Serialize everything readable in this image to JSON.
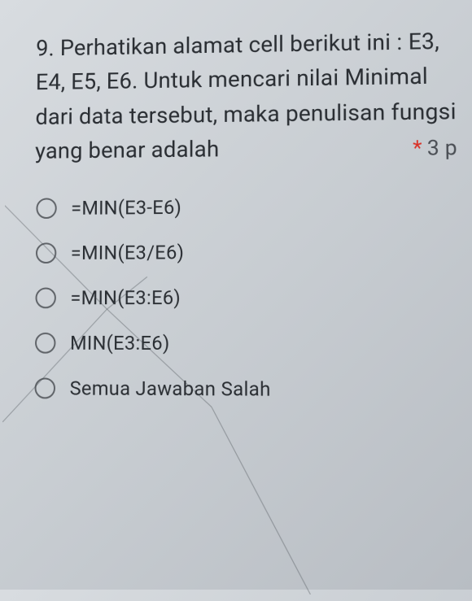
{
  "question": {
    "number": "9.",
    "text": "Perhatikan alamat cell berikut ini : E3, E4, E5, E6.  Untuk mencari nilai Minimal dari data tersebut, maka penulisan fungsi yang benar adalah",
    "required_mark": "*",
    "points": "3 p"
  },
  "options": [
    {
      "label": "=MIN(E3-E6)"
    },
    {
      "label": "=MIN(E3/E6)"
    },
    {
      "label": "=MIN(E3:E6)"
    },
    {
      "label": "MIN(E3:E6)"
    },
    {
      "label": "Semua Jawaban Salah"
    }
  ]
}
